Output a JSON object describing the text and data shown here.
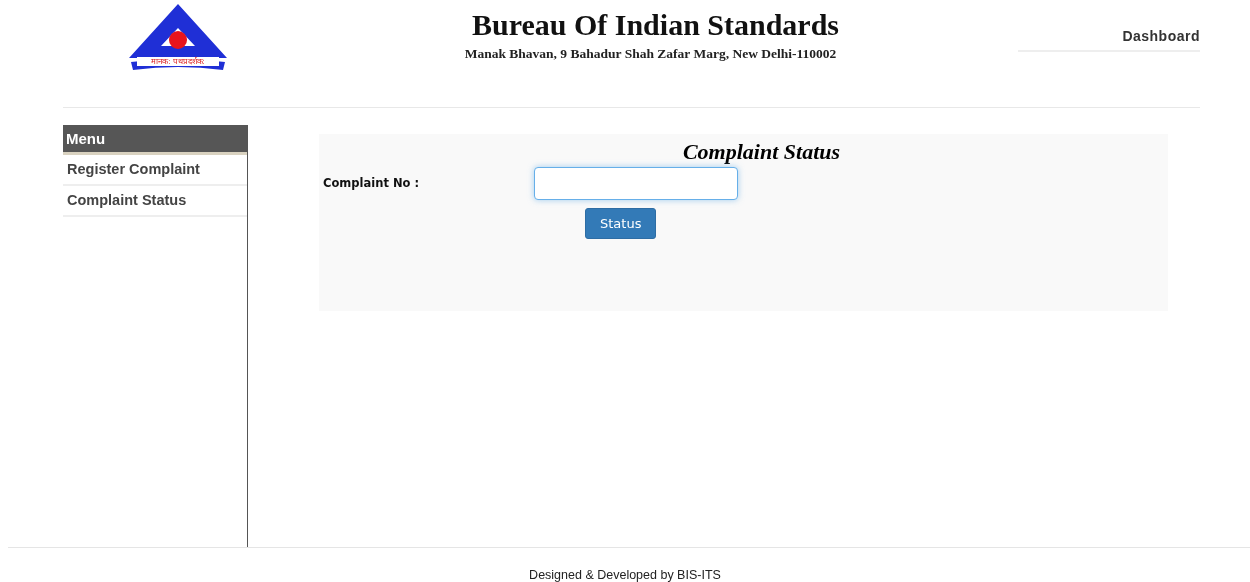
{
  "header": {
    "logo_text": "मानक: पथप्रदर्शक:",
    "title": "Bureau Of Indian Standards",
    "address": "Manak Bhavan, 9 Bahadur Shah Zafar Marg, New Delhi-110002",
    "nav_link": "Dashboard"
  },
  "sidebar": {
    "title": "Menu",
    "items": [
      {
        "label": "Register Complaint"
      },
      {
        "label": "Complaint Status"
      }
    ]
  },
  "form": {
    "title": "Complaint Status",
    "field_label": "Complaint No :",
    "button": "Status"
  },
  "footer": "Designed & Developed by BIS-ITS"
}
